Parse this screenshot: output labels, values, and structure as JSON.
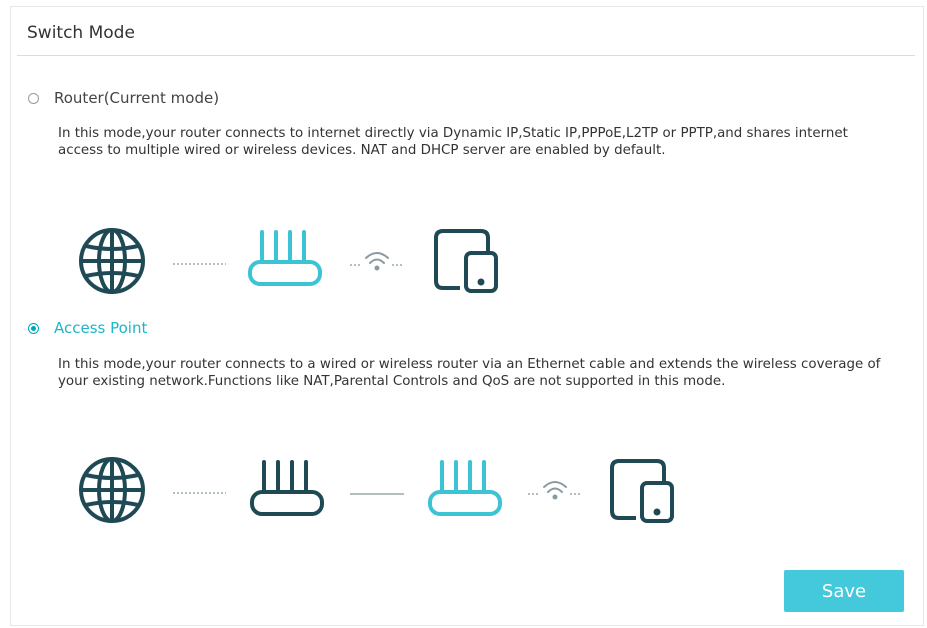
{
  "panel": {
    "title": "Switch Mode"
  },
  "modes": [
    {
      "label": "Router(Current mode)",
      "selected": false,
      "description": "In this mode,your router connects to internet directly via Dynamic IP,Static IP,PPPoE,L2TP or PPTP,and shares internet access to multiple wired or wireless devices. NAT and DHCP server are enabled by default."
    },
    {
      "label": "Access Point",
      "selected": true,
      "description": "In this mode,your router connects to a wired or wireless router via an Ethernet cable and extends the wireless coverage of your existing network.Functions like NAT,Parental Controls and QoS are not supported in this mode."
    }
  ],
  "icons": {
    "globe": "globe-icon",
    "router": "router-icon",
    "wifi": "wifi-icon",
    "devices": "devices-icon"
  },
  "colors": {
    "accent": "#1bb6c8",
    "button": "#44c9dc",
    "icon_dark": "#1f4a55",
    "icon_accent": "#3cc3d4"
  },
  "actions": {
    "save_label": "Save"
  }
}
